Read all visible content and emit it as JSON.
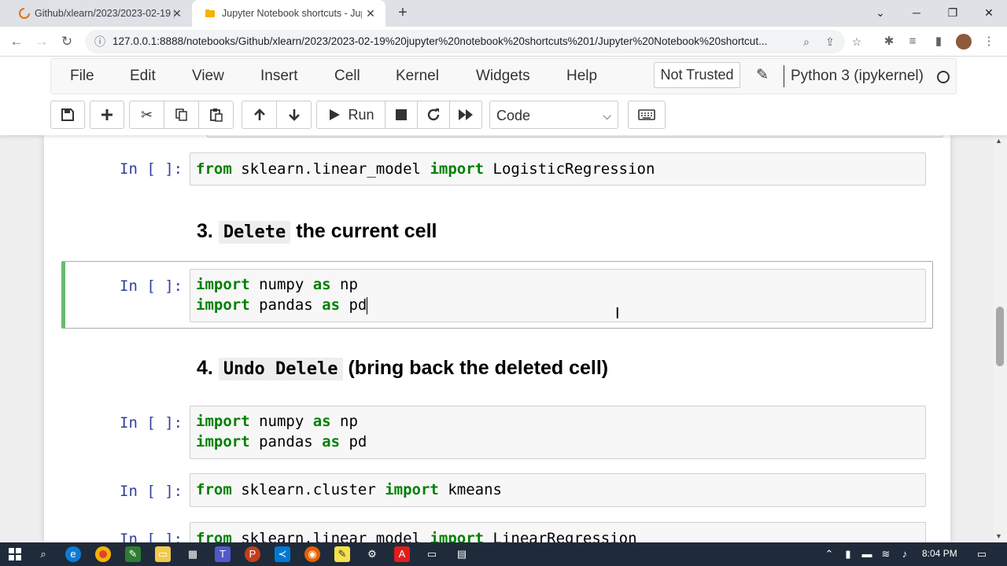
{
  "browser": {
    "tabs": [
      {
        "title": "Github/xlearn/2023/2023-02-19 |"
      },
      {
        "title": "Jupyter Notebook shortcuts - Jup"
      }
    ],
    "url": "127.0.0.1:8888/notebooks/Github/xlearn/2023/2023-02-19%20jupyter%20notebook%20shortcuts%201/Jupyter%20Notebook%20shortcut..."
  },
  "jupyter": {
    "menu": [
      "File",
      "Edit",
      "View",
      "Insert",
      "Cell",
      "Kernel",
      "Widgets",
      "Help"
    ],
    "trust_label": "Not Trusted",
    "kernel": "Python 3 (ipykernel)",
    "run_label": "Run",
    "cell_type": "Code"
  },
  "notebook": {
    "prompt": "In [ ]:",
    "cell1": {
      "kw1": "from",
      "mid": " sklearn.linear_model ",
      "kw2": "import",
      "rest": " LogisticRegression"
    },
    "heading3": {
      "num": "3.",
      "code": "Delete",
      "text": "the current cell"
    },
    "cell2": {
      "l1": {
        "kw1": "import",
        "mid": " numpy ",
        "kw2": "as",
        "rest": " np"
      },
      "l2": {
        "kw1": "import",
        "mid": " pandas ",
        "kw2": "as",
        "rest": " pd"
      }
    },
    "heading4": {
      "num": "4.",
      "code": "Undo Delele",
      "text": "(bring back the deleted cell)"
    },
    "cell3": {
      "l1": {
        "kw1": "import",
        "mid": " numpy ",
        "kw2": "as",
        "rest": " np"
      },
      "l2": {
        "kw1": "import",
        "mid": " pandas ",
        "kw2": "as",
        "rest": " pd"
      }
    },
    "cell4": {
      "kw1": "from",
      "mid": " sklearn.cluster ",
      "kw2": "import",
      "rest": " kmeans"
    },
    "cell5": {
      "kw1": "from",
      "mid": " sklearn.linear_model ",
      "kw2": "import",
      "rest": " LinearRegression"
    }
  },
  "taskbar": {
    "time": "8:04 PM"
  },
  "colors": {
    "selected_cell_border": "#66bb6a",
    "keyword": "#008000",
    "prompt": "#303f9f"
  }
}
